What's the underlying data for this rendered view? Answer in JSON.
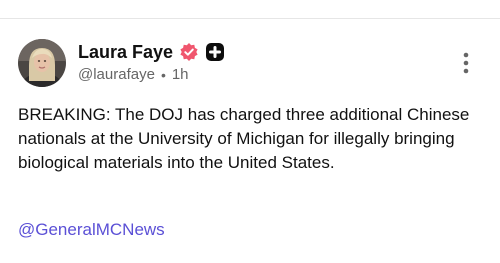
{
  "post": {
    "author": {
      "display_name": "Laura Faye",
      "handle": "@laurafaye",
      "verified_icon": "verified-check-icon",
      "badge_icon": "plus-badge-icon"
    },
    "timestamp": "1h",
    "menu_icon": "vertical-ellipsis-icon",
    "body_text": "BREAKING: The DOJ has charged three additional Chinese nationals at the University of Michigan for illegally bringing biological materials into the United States.",
    "mention": "@GeneralMCNews"
  },
  "colors": {
    "verified": "#f0566e",
    "badge": "#0d0d0d",
    "link": "#5b50d6",
    "muted_text": "#666666"
  }
}
